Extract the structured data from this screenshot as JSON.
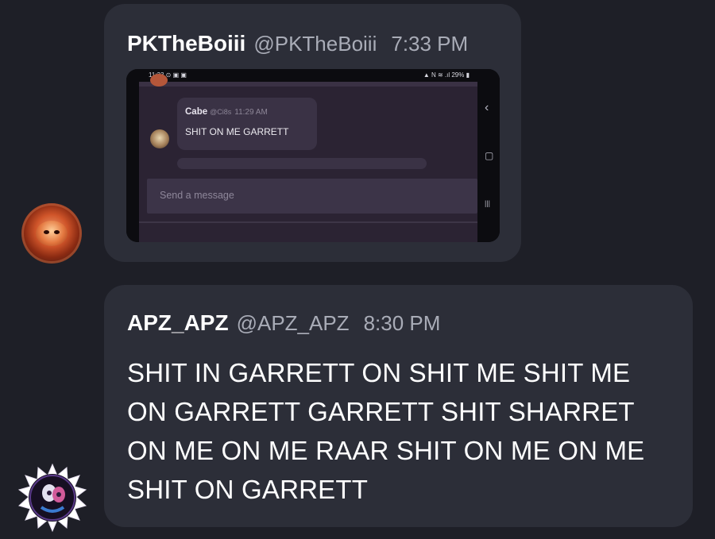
{
  "messages": [
    {
      "username": "PKTheBoiii",
      "handle": "@PKTheBoiii",
      "time": "7:33 PM",
      "avatar_icon": "orange-character-avatar",
      "attachment": {
        "status_time": "11:33 ⊙ ▣ ▣",
        "status_icons": "▲ N ≋ .ıl 29% ▮",
        "message_username": "Cabe",
        "message_handle": "@Ci8s",
        "message_time": "11:29 AM",
        "message_text": "SHIT ON ME GARRETT",
        "input_placeholder": "Send a message",
        "nav_back": "‹",
        "nav_home": "▢",
        "nav_recent": "|||"
      }
    },
    {
      "username": "APZ_APZ",
      "handle": "@APZ_APZ",
      "time": "8:30 PM",
      "avatar_icon": "spiky-badge-avatar",
      "text": "SHIT IN GARRETT ON SHIT ME SHIT ME ON GARRETT GARRETT SHIT SHARRET ON ME ON ME RAAR SHIT ON ME ON ME SHIT ON GARRETT"
    }
  ]
}
